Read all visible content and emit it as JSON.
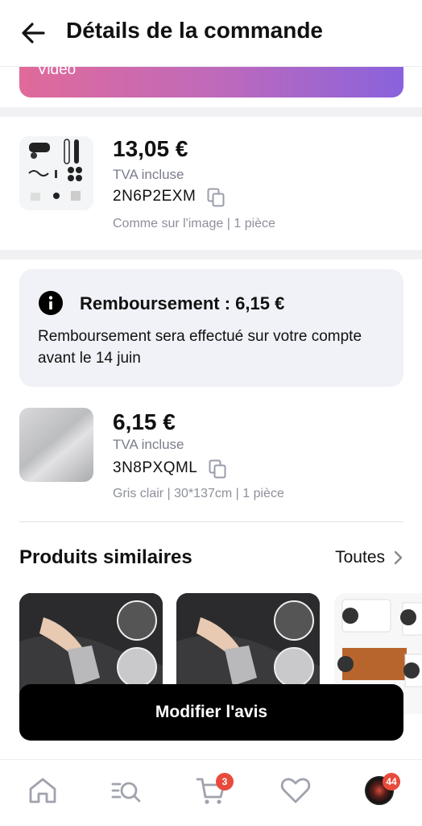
{
  "header": {
    "title": "Détails de la commande"
  },
  "banner": {
    "label": "Vidéo"
  },
  "order_items": [
    {
      "price": "13,05 €",
      "tax_note": "TVA incluse",
      "code": "2N6P2EXM",
      "variant": "Comme sur l'image | 1 pièce"
    },
    {
      "price": "6,15 €",
      "tax_note": "TVA incluse",
      "code": "3N8PXQML",
      "variant": "Gris clair | 30*137cm | 1 pièce"
    }
  ],
  "refund": {
    "title": "Remboursement : 6,15 €",
    "message": "Remboursement sera effectué sur votre compte avant le 14 juin"
  },
  "similar": {
    "title": "Produits similaires",
    "see_all": "Toutes"
  },
  "cta": {
    "label": "Modifier l'avis"
  },
  "nav": {
    "items": [
      "home-icon",
      "search-list-icon",
      "cart-icon",
      "heart-icon",
      "profile-avatar"
    ],
    "cart_badge": "3",
    "profile_badge": "44"
  },
  "colors": {
    "badge": "#e84b3c",
    "banner_start": "#e06a9a",
    "banner_end": "#8a62dc",
    "cta": "#000000"
  }
}
